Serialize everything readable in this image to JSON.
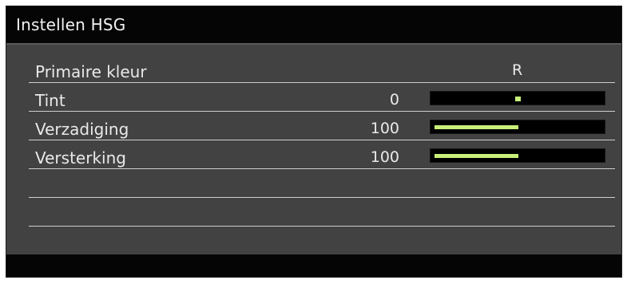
{
  "window": {
    "title": "Instellen HSG"
  },
  "menu": {
    "primary_color": {
      "label": "Primaire kleur",
      "value": "R"
    },
    "rows": [
      {
        "label": "Tint",
        "value": "0",
        "level": 0.0,
        "slider_style": "centered-marker"
      },
      {
        "label": "Verzadiging",
        "value": "100",
        "level": 0.5,
        "slider_style": "bar-fill"
      },
      {
        "label": "Versterking",
        "value": "100",
        "level": 0.5,
        "slider_style": "bar-fill"
      }
    ],
    "slider_color": "#c8f07a",
    "background_color": "#424242"
  }
}
